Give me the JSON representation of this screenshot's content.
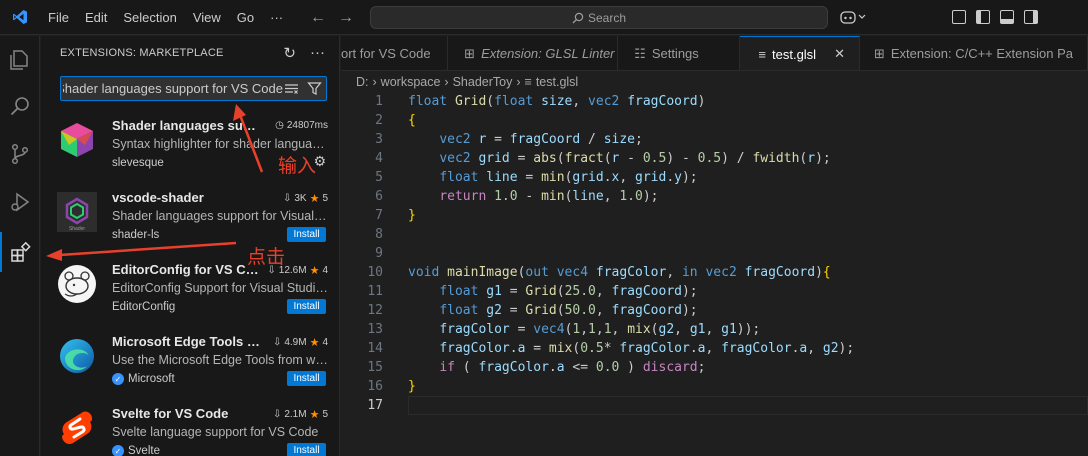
{
  "menu": [
    "File",
    "Edit",
    "Selection",
    "View",
    "Go",
    "···"
  ],
  "command_center": {
    "placeholder": "Search"
  },
  "sidebar": {
    "title": "EXTENSIONS: MARKETPLACE",
    "search_value": "Shader languages support for VS Code",
    "extensions": [
      {
        "name": "Shader languages support for VS Code",
        "stats": "24807ms",
        "stats_icon": "clock-icon",
        "description": "Syntax highlighter for shader languages",
        "publisher": "slevesque",
        "verified": false,
        "action": "gear"
      },
      {
        "name": "vscode-shader",
        "stats": "3K",
        "rating": "5",
        "description": "Shader languages support for Visual Studio Code",
        "publisher": "shader-ls",
        "verified": false,
        "action": "Install"
      },
      {
        "name": "EditorConfig for VS Code",
        "stats": "12.6M",
        "rating": "4",
        "description": "EditorConfig Support for Visual Studio Code",
        "publisher": "EditorConfig",
        "verified": false,
        "action": "Install"
      },
      {
        "name": "Microsoft Edge Tools for VS Code",
        "stats": "4.9M",
        "rating": "4",
        "description": "Use the Microsoft Edge Tools from within VS Code",
        "publisher": "Microsoft",
        "verified": true,
        "action": "Install"
      },
      {
        "name": "Svelte for VS Code",
        "stats": "2.1M",
        "rating": "5",
        "description": "Svelte language support for VS Code",
        "publisher": "Svelte",
        "verified": true,
        "action": "Install"
      }
    ]
  },
  "tabs": [
    {
      "label": "ort for VS Code",
      "italic": false,
      "active": false
    },
    {
      "label": "Extension: GLSL Linter",
      "italic": true,
      "active": false
    },
    {
      "label": "Settings",
      "italic": false,
      "active": false
    },
    {
      "label": "test.glsl",
      "italic": false,
      "active": true
    },
    {
      "label": "Extension: C/C++ Extension Pa",
      "italic": false,
      "active": false
    }
  ],
  "breadcrumb": [
    "D:",
    "workspace",
    "ShaderToy",
    "test.glsl"
  ],
  "code_lines": [
    "float Grid(float size, vec2 fragCoord)",
    "{",
    "    vec2 r = fragCoord / size;",
    "    vec2 grid = abs(fract(r - 0.5) - 0.5) / fwidth(r);",
    "    float line = min(grid.x, grid.y);",
    "    return 1.0 - min(line, 1.0);",
    "}",
    "",
    "",
    "void mainImage(out vec4 fragColor, in vec2 fragCoord){",
    "    float g1 = Grid(25.0, fragCoord);",
    "    float g2 = Grid(50.0, fragCoord);",
    "    fragColor = vec4(1,1,1, mix(g2, g1, g1));",
    "    fragColor.a = mix(0.5* fragColor.a, fragColor.a, g2);",
    "    if ( fragColor.a <= 0.0 ) discard;",
    "}",
    ""
  ],
  "annotations": {
    "input_label": "输入",
    "click_label": "点击"
  },
  "colors": {
    "accent": "#0078d4",
    "annotation": "#e8402a",
    "keyword": "#569cd6",
    "function": "#dcdcaa",
    "number": "#b5cea8",
    "control": "#c586c0",
    "bracket": "#ffd700"
  }
}
